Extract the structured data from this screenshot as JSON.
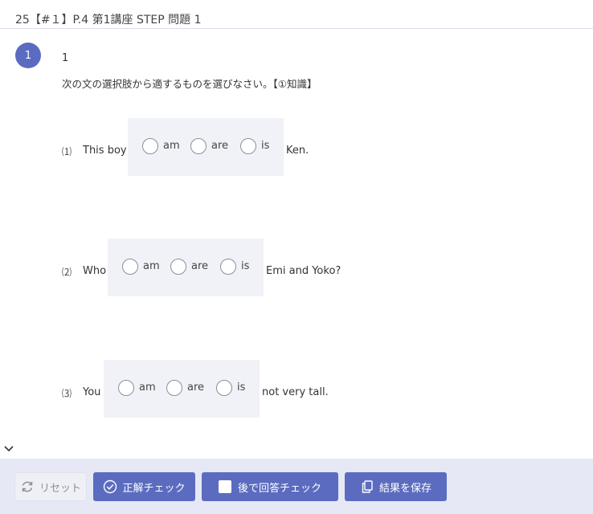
{
  "header": {
    "title": "25【#１】P.4 第1講座 STEP 問題 1"
  },
  "question": {
    "badge": "1",
    "number": "1",
    "instruction": "次の文の選択肢から適するものを選びなさい。【①知識】",
    "items": [
      {
        "num": "⑴",
        "pre": "This boy",
        "options": [
          "am",
          "are",
          "is"
        ],
        "post": "Ken."
      },
      {
        "num": "⑵",
        "pre": "Who",
        "options": [
          "am",
          "are",
          "is"
        ],
        "post": "Emi and Yoko?"
      },
      {
        "num": "⑶",
        "pre": "You",
        "options": [
          "am",
          "are",
          "is"
        ],
        "post": "not very tall."
      }
    ]
  },
  "toolbar": {
    "reset_label": "リセット",
    "check_label": "正解チェック",
    "later_label": "後で回答チェック",
    "save_label": "結果を保存"
  },
  "colors": {
    "accent": "#5b6cc0",
    "bar_bg": "#e6e9f5",
    "choice_bg": "#f1f2f7"
  }
}
